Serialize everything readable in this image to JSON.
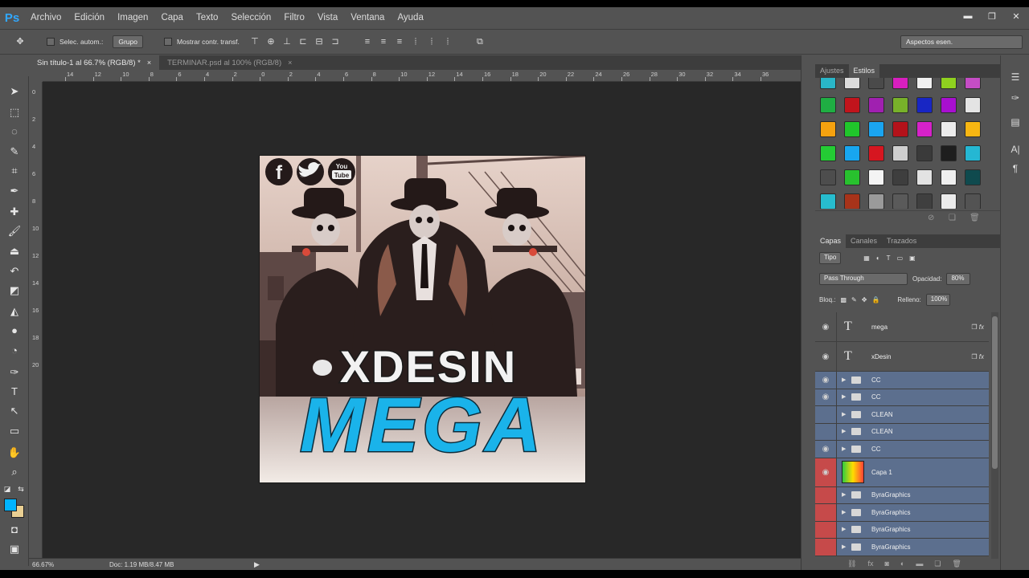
{
  "app": {
    "logo": "Ps"
  },
  "menu": [
    "Archivo",
    "Edición",
    "Imagen",
    "Capa",
    "Texto",
    "Selección",
    "Filtro",
    "Vista",
    "Ventana",
    "Ayuda"
  ],
  "window_controls": {
    "minimize": "▬",
    "restore": "❐",
    "close": "✕"
  },
  "options": {
    "auto_select_label": "Selec. autom.:",
    "group_select": "Grupo",
    "show_transform_label": "Mostrar contr. transf.",
    "workspace_select": "Aspectos esen."
  },
  "tabs": [
    {
      "label": "Sin título-1 al 66.7% (RGB/8) *",
      "close": "×"
    },
    {
      "label": "TERMINAR.psd al 100% (RGB/8)",
      "close": "×"
    }
  ],
  "ruler_h": [
    "14",
    "12",
    "10",
    "8",
    "6",
    "4",
    "2",
    "0",
    "2",
    "4",
    "6",
    "8",
    "10",
    "12",
    "14",
    "16",
    "18",
    "20",
    "22",
    "24",
    "26",
    "28",
    "30",
    "32",
    "34",
    "36"
  ],
  "ruler_v": [
    "0",
    "2",
    "4",
    "6",
    "8",
    "10",
    "12",
    "14",
    "16",
    "18",
    "20"
  ],
  "artwork": {
    "title_top": "XDESIN",
    "title_bottom": "MEGA",
    "social_facebook": "f",
    "social_youtube": "You Tube"
  },
  "status": {
    "zoom": "66.67%",
    "doc": "Doc: 1.19 MB/8.47 MB"
  },
  "styles_panel": {
    "tabs": [
      "Ajustes",
      "Estilos"
    ],
    "active_tab": "Estilos",
    "swatches": [
      [
        "#29b6c8",
        "#dcdcdc",
        "#4a4a4a",
        "#d81fbf",
        "#f0f0f0",
        "#8fd11f",
        "#c54dc5"
      ],
      [
        "#1fae43",
        "#c1141c",
        "#a020b0",
        "#78b12a",
        "#1826c4",
        "#a80fd0",
        "#e4e4e4"
      ],
      [
        "#f6a20f",
        "#20c62b",
        "#1aa4f0",
        "#b4121a",
        "#d622c9",
        "#ececec",
        "#f8b612"
      ],
      [
        "#24cc34",
        "#18a6ef",
        "#d61620",
        "#cfcfcf",
        "#3a3a3a",
        "#1e1e1e",
        "#25b7d3"
      ],
      [
        "#4d4d4d",
        "#28c12e",
        "#f4f4f4",
        "#3e3e3e",
        "#e3e3e3",
        "#efefef",
        "#0f4a4e"
      ],
      [
        "#27bdcf",
        "#a8331a",
        "#9a9a9a",
        "#5a5a5a",
        "#3f3f3f",
        "#ebebeb",
        "#535353"
      ]
    ]
  },
  "layers_panel": {
    "tabs": [
      "Capas",
      "Canales",
      "Trazados"
    ],
    "active_tab": "Capas",
    "filter": "Tipo",
    "blend_mode": "Pass Through",
    "opacity_label": "Opacidad:",
    "opacity_value": "80%",
    "lock_label": "Bloq.:",
    "fill_label": "Relleno:",
    "fill_value": "100%",
    "layers": [
      {
        "name": "mega",
        "kind": "text"
      },
      {
        "name": "xDesin",
        "kind": "text"
      },
      {
        "name": "CC",
        "kind": "group"
      },
      {
        "name": "CC",
        "kind": "group"
      },
      {
        "name": "CLEAN",
        "kind": "group"
      },
      {
        "name": "CLEAN",
        "kind": "group"
      },
      {
        "name": "CC",
        "kind": "group"
      },
      {
        "name": "Capa 1",
        "kind": "image"
      },
      {
        "name": "ByraGraphics",
        "kind": "group"
      },
      {
        "name": "ByraGraphics",
        "kind": "group"
      },
      {
        "name": "ByraGraphics",
        "kind": "group"
      },
      {
        "name": "ByraGraphics",
        "kind": "group"
      }
    ]
  }
}
